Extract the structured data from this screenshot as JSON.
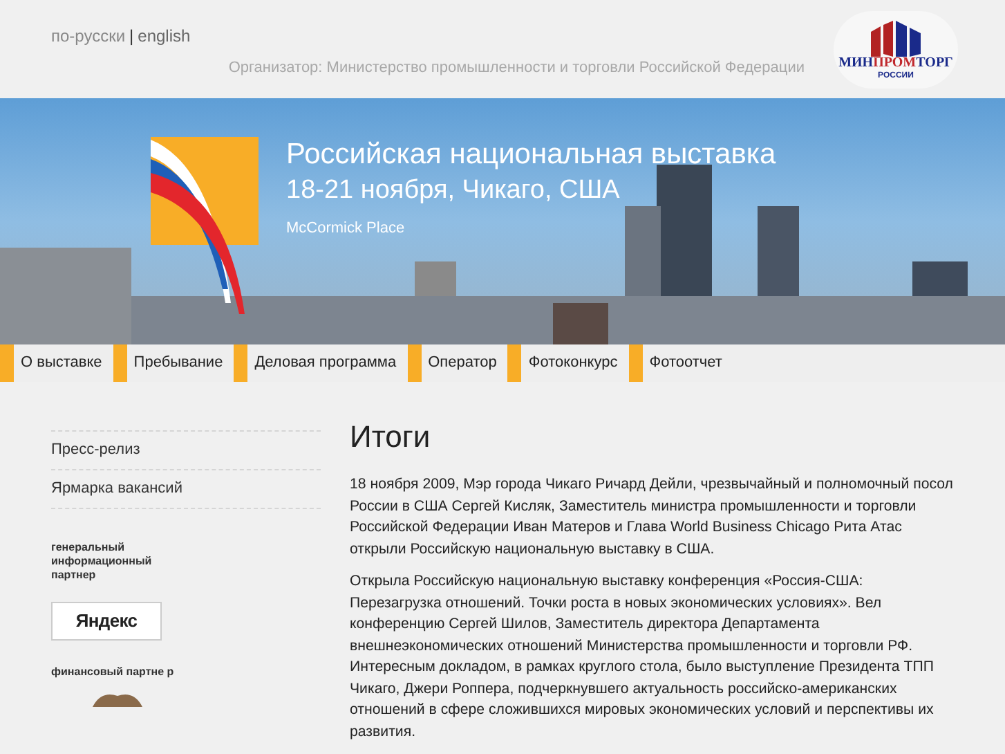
{
  "header": {
    "languages": [
      {
        "label": "по-русски",
        "selected": true
      },
      {
        "label": "english",
        "selected": false
      }
    ],
    "separator": "|",
    "organizer": "Организатор: Министерство промышленности и торговли Российской Федерации",
    "logo": {
      "title_dark": "МИН",
      "title_red": "ПРОМ",
      "title_dark2": "ТОРГ",
      "subtitle": "РОССИИ"
    }
  },
  "hero": {
    "title": "Российская национальная выставка",
    "subtitle": "18-21 ноября, Чикаго, США",
    "venue": "McCormick Place"
  },
  "nav": [
    "О выставке",
    "Пребывание",
    "Деловая программа",
    "Оператор",
    "Фотоконкурс",
    "Фотоотчет"
  ],
  "sidebar": {
    "links": [
      "Пресс-релиз",
      "Ярмарка вакансий"
    ],
    "partners": [
      {
        "kind": "info",
        "label": "генеральный информационный партнер",
        "logo_text": "Яндекс"
      },
      {
        "kind": "finance",
        "label": "финансовый партне р"
      }
    ]
  },
  "article": {
    "title": "Итоги",
    "paragraphs": [
      "18 ноября 2009, Мэр города Чикаго Ричард Дейли, чрезвычайный и полномочный посол России в США Сергей Кисляк, Заместитель министра промышленности и торговли Российской Федерации Иван Матеров и Глава World Business Chicago Рита Атас открыли Российскую национальную выставку в США.",
      "Открыла Российскую национальную выставку конференция «Россия-США: Перезагрузка отношений. Точки роста в новых экономических условиях». Вел конференцию Сергей Шилов, Заместитель директора Департамента внешнеэкономических отношений Министерства промышленности и торговли РФ. Интересным докладом, в рамках круглого стола, было выступление Президента ТПП Чикаго, Джери Роппера, подчеркнувшего актуальность российско-американских отношений в сфере сложившихся мировых экономических условий и перспективы их развития."
    ]
  }
}
